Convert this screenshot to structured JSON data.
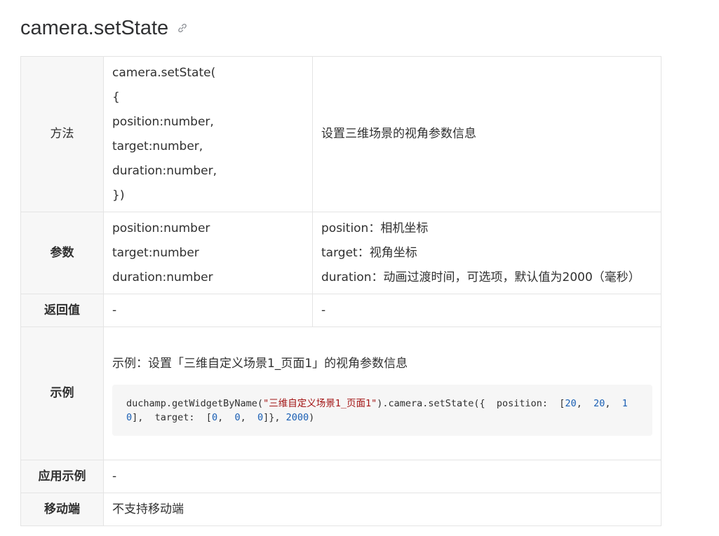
{
  "title": "camera.setState",
  "rows": {
    "method": {
      "label": "方法",
      "code_lines": [
        "camera.setState(",
        "{",
        "position:number,",
        "target:number,",
        "duration:number,",
        "})"
      ],
      "description": "设置三维场景的视角参数信息"
    },
    "params": {
      "label": "参数",
      "names": [
        "position:number",
        "target:number",
        "duration:number"
      ],
      "descriptions": [
        "position：相机坐标",
        "target：视角坐标",
        "duration：动画过渡时间，可选项，默认值为2000（毫秒）"
      ]
    },
    "return": {
      "label": "返回值",
      "value": "-",
      "description": "-"
    },
    "example": {
      "label": "示例",
      "description": "示例：设置「三维自定义场景1_页面1」的视角参数信息",
      "code": {
        "prefix": "duchamp.getWidgetByName(",
        "string": "\"三维自定义场景1_页面1\"",
        "mid1": ").camera.setState({  position:  [",
        "n1": "20",
        "sep1": ",  ",
        "n2": "20",
        "sep2": ",  ",
        "n3": "10",
        "mid2": "],  target:  [",
        "n4": "0",
        "sep3": ",  ",
        "n5": "0",
        "sep4": ",  ",
        "n6": "0",
        "mid3": "]}, ",
        "n7": "2000",
        "suffix": ")"
      }
    },
    "app_example": {
      "label": "应用示例",
      "value": "-"
    },
    "mobile": {
      "label": "移动端",
      "value": "不支持移动端"
    }
  },
  "colors": {
    "border": "#e4e4e4",
    "label_bg": "#f7f7f7",
    "code_bg": "#f6f6f6",
    "code_string": "#a31515",
    "code_number": "#1a5fb4"
  },
  "icons": {
    "title_anchor": "link-icon"
  }
}
